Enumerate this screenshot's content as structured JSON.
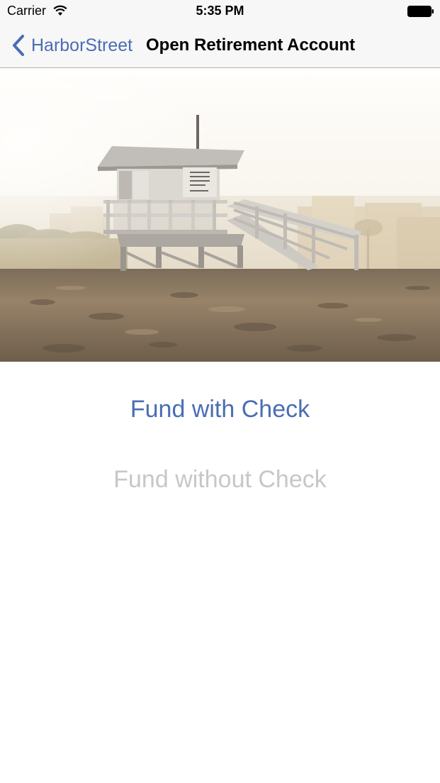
{
  "status_bar": {
    "carrier": "Carrier",
    "time": "5:35 PM",
    "wifi_icon": "wifi-icon",
    "battery_icon": "battery-icon"
  },
  "nav_bar": {
    "back_label": "HarborStreet",
    "back_icon": "chevron-left-icon",
    "title": "Open Retirement Account"
  },
  "hero": {
    "image": "lifeguard-tower-beach-photo"
  },
  "actions": {
    "fund_with_check": "Fund with Check",
    "fund_without_check": "Fund without Check"
  },
  "colors": {
    "accent": "#4a6db4",
    "disabled": "#c7c7c7",
    "bar_background": "#f7f7f7"
  }
}
